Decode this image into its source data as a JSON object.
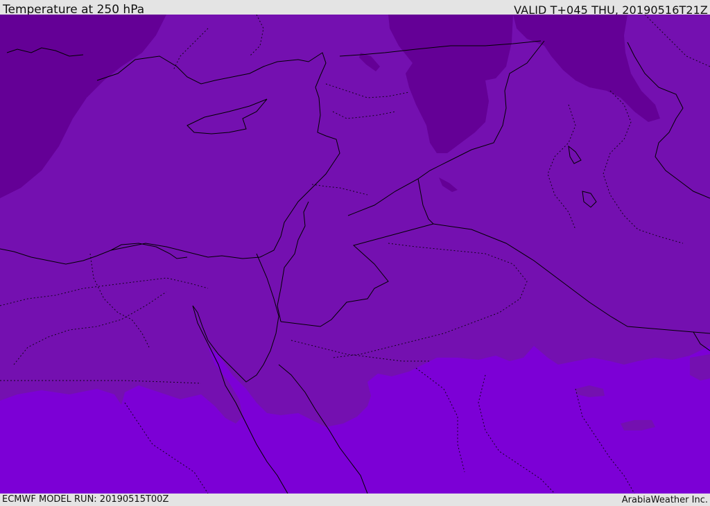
{
  "header": {
    "title": "Temperature at 250 hPa",
    "valid": "VALID T+045 THU, 20190516T21Z"
  },
  "footer": {
    "model_run": "ECMWF MODEL RUN: 20190515T00Z",
    "credit": "ArabiaWeather Inc."
  },
  "map": {
    "colors": {
      "cold_zone": "#640096",
      "mid_zone": "#7410b0",
      "warm_zone": "#7c00d6",
      "coast_line": "#000000"
    }
  }
}
